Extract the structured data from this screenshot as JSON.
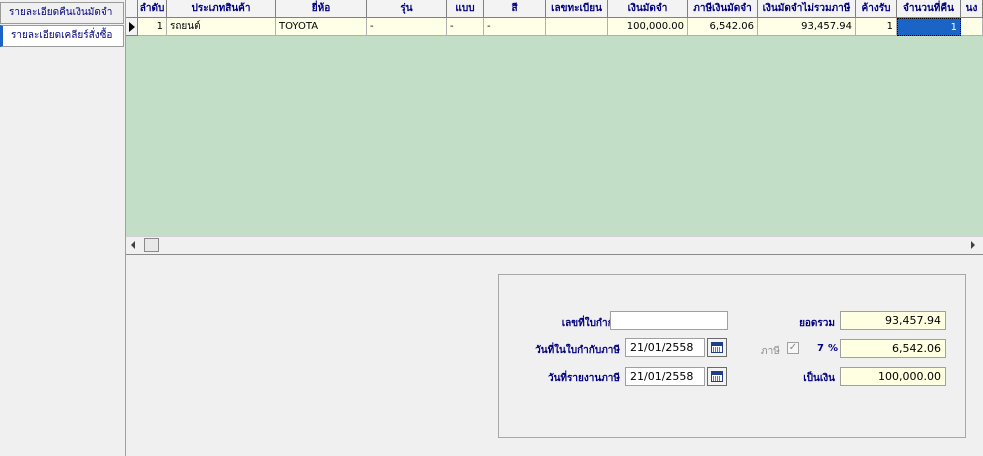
{
  "tabs": [
    {
      "label": "รายละเอียดคืนเงินมัดจำ"
    },
    {
      "label": "รายละเอียดเคลียร์สั่งซื้อ"
    }
  ],
  "grid": {
    "headers": [
      "ลำดับ",
      "ประเภทสินค้า",
      "ยี่ห้อ",
      "รุ่น",
      "แบบ",
      "สี",
      "เลขทะเบียน",
      "เงินมัดจำ",
      "ภาษีเงินมัดจำ",
      "เงินมัดจำไม่รวมภาษี",
      "ค้างรับ",
      "จำนวนที่คืน",
      "นง"
    ],
    "rows": [
      [
        "1",
        "รถยนต์",
        "TOYOTA",
        "-",
        "-",
        "-",
        "",
        "100,000.00",
        "6,542.06",
        "93,457.94",
        "1",
        "1",
        ""
      ]
    ]
  },
  "summary": {
    "ref_doc_label": "เลขที่ใบกำกับ",
    "ref_doc_value": "",
    "invoice_date_label": "วันที่ในใบกำกับภาษี",
    "invoice_date_value": "21/01/2558",
    "report_date_label": "วันที่รายงานภาษี",
    "report_date_value": "21/01/2558",
    "total_label": "ยอดรวม",
    "total_value": "93,457.94",
    "tax_label": "ภาษี",
    "tax_rate": "7",
    "tax_pct_symbol": "%",
    "tax_value": "6,542.06",
    "net_label": "เป็นเงิน",
    "net_value": "100,000.00"
  }
}
